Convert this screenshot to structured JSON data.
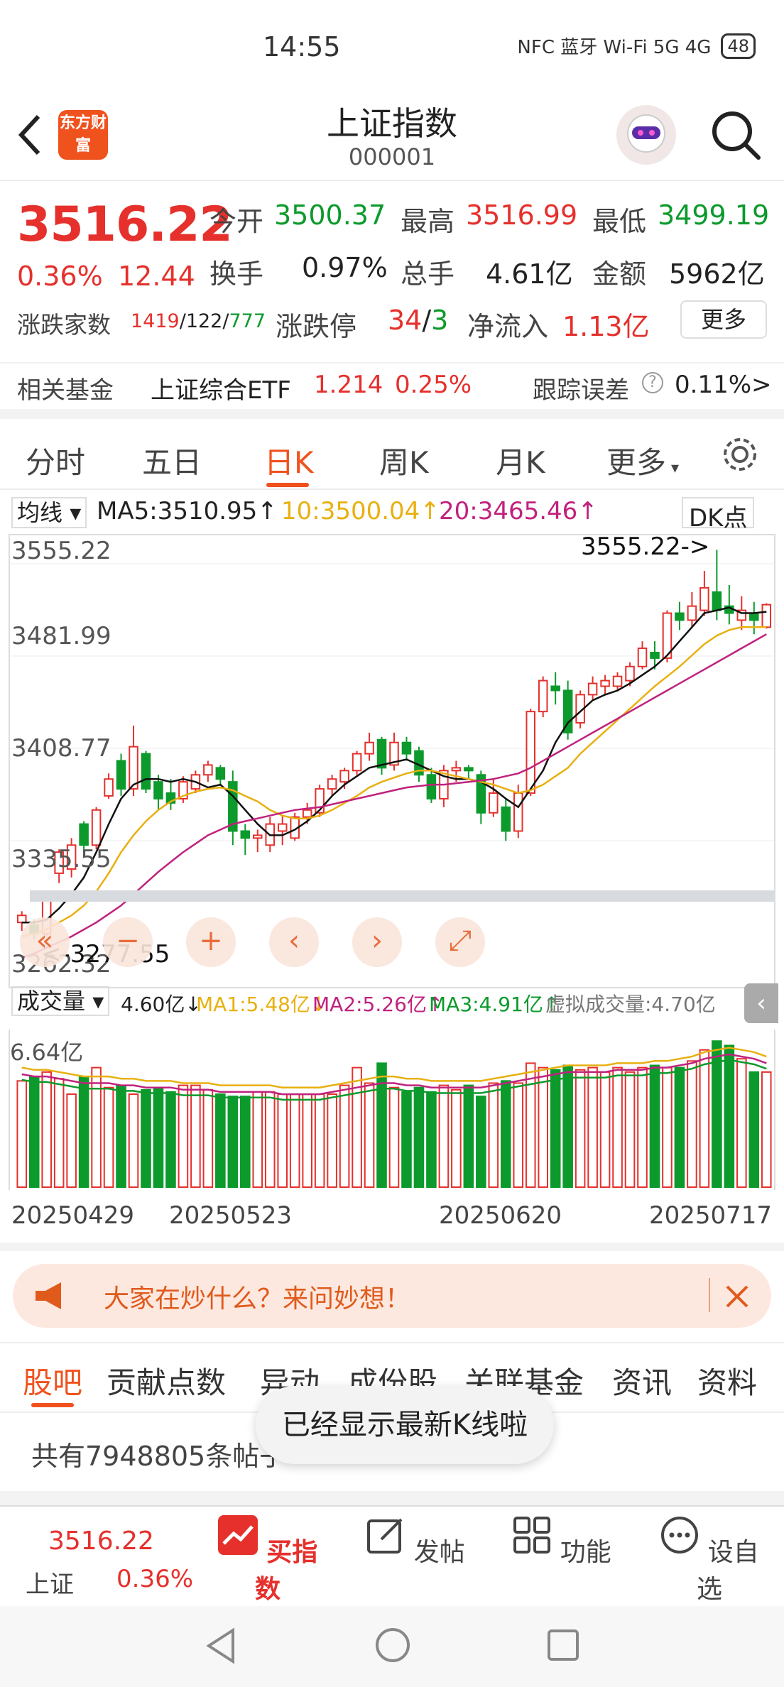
{
  "status_bar": {
    "time": "14:55",
    "icons": "NFC 蓝牙 Wi-Fi 5G 4G",
    "battery": "48"
  },
  "nav": {
    "logo": "东方财富",
    "title": "上证指数",
    "code": "000001"
  },
  "quote": {
    "price": "3516.22",
    "pct": "0.36%",
    "change": "12.44",
    "open_label": "今开",
    "open": "3500.37",
    "high_label": "最高",
    "high": "3516.99",
    "low_label": "最低",
    "low": "3499.19",
    "turnover_label": "换手",
    "turnover": "0.97%",
    "vol_label": "总手",
    "vol": "4.61亿",
    "amount_label": "金额",
    "amount": "5962亿",
    "breadth_label": "涨跌家数",
    "breadth_up": "1419",
    "breadth_flat": "122",
    "breadth_down": "777",
    "limit_label": "涨跌停",
    "limit_up": "34",
    "limit_down": "3",
    "inflow_label": "净流入",
    "inflow": "1.13亿",
    "more": "更多"
  },
  "fund": {
    "label": "相关基金",
    "name": "上证综合ETF",
    "price": "1.214",
    "pct": "0.25%",
    "err_label": "跟踪误差",
    "err": "0.11%"
  },
  "tabs": [
    "分时",
    "五日",
    "日K",
    "周K",
    "月K",
    "更多"
  ],
  "ma": {
    "select": "均线",
    "ma5": "MA5:3510.95↑",
    "ma10": "10:3500.04↑",
    "ma20": "20:3465.46↑",
    "dk": "DK点"
  },
  "chart_data": {
    "type": "candlestick",
    "y_ticks": [
      "3555.22",
      "3481.99",
      "3408.77",
      "3335.55",
      "3262.32"
    ],
    "ylim": [
      3262.32,
      3555.22
    ],
    "max_label": "3555.22->",
    "min_label": "<-3277.55",
    "candles": [
      [
        3290,
        3295,
        3284,
        3298
      ],
      [
        3288,
        3282,
        3278,
        3292
      ],
      [
        3282,
        3310,
        3280,
        3312
      ],
      [
        3325,
        3340,
        3318,
        3342
      ],
      [
        3328,
        3345,
        3322,
        3350
      ],
      [
        3360,
        3345,
        3340,
        3362
      ],
      [
        3345,
        3370,
        3342,
        3372
      ],
      [
        3380,
        3392,
        3378,
        3396
      ],
      [
        3405,
        3385,
        3380,
        3410
      ],
      [
        3385,
        3415,
        3380,
        3430
      ],
      [
        3410,
        3385,
        3382,
        3412
      ],
      [
        3390,
        3378,
        3370,
        3395
      ],
      [
        3382,
        3375,
        3370,
        3392
      ],
      [
        3378,
        3390,
        3375,
        3394
      ],
      [
        3385,
        3395,
        3382,
        3398
      ],
      [
        3395,
        3402,
        3390,
        3405
      ],
      [
        3400,
        3392,
        3388,
        3402
      ],
      [
        3390,
        3355,
        3345,
        3398
      ],
      [
        3355,
        3350,
        3338,
        3360
      ],
      [
        3350,
        3352,
        3340,
        3356
      ],
      [
        3345,
        3360,
        3340,
        3365
      ],
      [
        3355,
        3360,
        3345,
        3366
      ],
      [
        3350,
        3365,
        3348,
        3368
      ],
      [
        3365,
        3370,
        3360,
        3375
      ],
      [
        3368,
        3385,
        3365,
        3388
      ],
      [
        3385,
        3392,
        3380,
        3395
      ],
      [
        3390,
        3398,
        3385,
        3400
      ],
      [
        3398,
        3410,
        3395,
        3412
      ],
      [
        3410,
        3418,
        3405,
        3425
      ],
      [
        3420,
        3400,
        3395,
        3422
      ],
      [
        3402,
        3418,
        3398,
        3425
      ],
      [
        3418,
        3410,
        3405,
        3422
      ],
      [
        3412,
        3395,
        3390,
        3415
      ],
      [
        3395,
        3378,
        3375,
        3400
      ],
      [
        3378,
        3398,
        3372,
        3402
      ],
      [
        3398,
        3400,
        3390,
        3405
      ],
      [
        3400,
        3398,
        3392,
        3402
      ],
      [
        3395,
        3368,
        3360,
        3398
      ],
      [
        3368,
        3382,
        3365,
        3392
      ],
      [
        3372,
        3355,
        3348,
        3378
      ],
      [
        3355,
        3382,
        3350,
        3388
      ],
      [
        3382,
        3440,
        3380,
        3442
      ],
      [
        3440,
        3462,
        3436,
        3465
      ],
      [
        3458,
        3455,
        3445,
        3468
      ],
      [
        3455,
        3425,
        3420,
        3462
      ],
      [
        3432,
        3452,
        3428,
        3455
      ],
      [
        3452,
        3460,
        3448,
        3465
      ],
      [
        3458,
        3462,
        3452,
        3466
      ],
      [
        3458,
        3465,
        3455,
        3468
      ],
      [
        3462,
        3472,
        3458,
        3475
      ],
      [
        3472,
        3485,
        3470,
        3490
      ],
      [
        3482,
        3478,
        3470,
        3490
      ],
      [
        3478,
        3510,
        3475,
        3512
      ],
      [
        3510,
        3505,
        3498,
        3518
      ],
      [
        3505,
        3515,
        3500,
        3525
      ],
      [
        3512,
        3528,
        3508,
        3540
      ],
      [
        3525,
        3512,
        3505,
        3555
      ],
      [
        3515,
        3510,
        3502,
        3530
      ],
      [
        3505,
        3512,
        3498,
        3522
      ],
      [
        3510,
        3505,
        3495,
        3518
      ],
      [
        3500,
        3516,
        3499,
        3517
      ]
    ],
    "ma5": [
      3290,
      3290,
      3292,
      3300,
      3310,
      3322,
      3340,
      3360,
      3378,
      3388,
      3392,
      3392,
      3390,
      3392,
      3390,
      3386,
      3388,
      3380,
      3370,
      3360,
      3352,
      3352,
      3356,
      3362,
      3370,
      3380,
      3388,
      3394,
      3400,
      3402,
      3404,
      3406,
      3402,
      3398,
      3394,
      3392,
      3392,
      3390,
      3385,
      3378,
      3372,
      3385,
      3398,
      3418,
      3432,
      3440,
      3448,
      3452,
      3455,
      3460,
      3466,
      3472,
      3480,
      3490,
      3500,
      3510,
      3512,
      3514,
      3510,
      3510,
      3511
    ],
    "ma10": [
      3280,
      3282,
      3285,
      3290,
      3295,
      3302,
      3312,
      3325,
      3340,
      3352,
      3362,
      3370,
      3376,
      3380,
      3383,
      3385,
      3386,
      3384,
      3380,
      3376,
      3370,
      3366,
      3364,
      3364,
      3366,
      3370,
      3375,
      3380,
      3386,
      3390,
      3393,
      3396,
      3398,
      3398,
      3396,
      3394,
      3392,
      3390,
      3388,
      3385,
      3382,
      3384,
      3388,
      3394,
      3400,
      3410,
      3418,
      3426,
      3434,
      3442,
      3450,
      3458,
      3465,
      3472,
      3480,
      3488,
      3494,
      3498,
      3500,
      3500,
      3500
    ],
    "ma20": [
      3265,
      3268,
      3272,
      3276,
      3280,
      3285,
      3290,
      3296,
      3302,
      3310,
      3318,
      3326,
      3333,
      3340,
      3346,
      3352,
      3356,
      3360,
      3362,
      3364,
      3366,
      3368,
      3370,
      3371,
      3372,
      3374,
      3376,
      3378,
      3380,
      3382,
      3384,
      3386,
      3387,
      3388,
      3388,
      3389,
      3390,
      3391,
      3392,
      3394,
      3396,
      3400,
      3405,
      3410,
      3415,
      3420,
      3425,
      3430,
      3435,
      3440,
      3445,
      3450,
      3455,
      3460,
      3465,
      3470,
      3475,
      3480,
      3485,
      3490,
      3495
    ]
  },
  "chart_controls": [
    "back-icon",
    "zoom-out-icon",
    "zoom-in-icon",
    "pan-left-icon",
    "pan-right-icon",
    "fullscreen-icon"
  ],
  "volume": {
    "select": "成交量",
    "vol": "4.60亿↓",
    "ma1": "MA1:5.48亿↓",
    "ma2": "MA2:5.26亿↑",
    "ma3": "MA3:4.91亿↑",
    "virtual": "虚拟成交量:4.70亿",
    "max_label": "6.64亿",
    "values": [
      4.8,
      5.0,
      5.2,
      4.9,
      4.2,
      5.0,
      5.4,
      4.5,
      4.6,
      4.2,
      4.4,
      4.5,
      4.3,
      4.6,
      4.6,
      4.4,
      4.2,
      4.1,
      4.1,
      4.3,
      4.3,
      4.2,
      4.2,
      4.2,
      4.2,
      4.2,
      4.6,
      5.4,
      4.7,
      5.6,
      4.5,
      4.3,
      4.5,
      4.3,
      4.6,
      4.4,
      4.6,
      4.1,
      4.7,
      4.8,
      4.7,
      5.6,
      5.4,
      5.3,
      5.5,
      5.3,
      5.4,
      5.2,
      5.4,
      5.2,
      5.4,
      5.5,
      5.4,
      5.4,
      5.7,
      6.2,
      6.6,
      6.4,
      5.8,
      5.2,
      5.2
    ],
    "ma_line": [
      5.1,
      5.0,
      5.0,
      4.9,
      4.8,
      4.7,
      4.7,
      4.7,
      4.6,
      4.6,
      4.5,
      4.5,
      4.5,
      4.4,
      4.4,
      4.4,
      4.3,
      4.3,
      4.3,
      4.3,
      4.3,
      4.2,
      4.2,
      4.2,
      4.2,
      4.3,
      4.4,
      4.5,
      4.6,
      4.7,
      4.7,
      4.6,
      4.6,
      4.5,
      4.5,
      4.5,
      4.5,
      4.5,
      4.6,
      4.7,
      4.8,
      4.9,
      5.0,
      5.1,
      5.2,
      5.2,
      5.2,
      5.2,
      5.3,
      5.3,
      5.3,
      5.4,
      5.4,
      5.5,
      5.6,
      5.8,
      5.9,
      6.0,
      5.9,
      5.8,
      5.6
    ]
  },
  "dates": [
    "20250429",
    "20250523",
    "20250620",
    "20250717"
  ],
  "banner": {
    "text": "大家在炒什么？来问妙想！"
  },
  "bottom_tabs": [
    "股吧",
    "贡献点数",
    "异动",
    "成份股",
    "关联基金",
    "资讯",
    "资料"
  ],
  "post_count": "共有7948805条帖子",
  "toast": "已经显示最新K线啦",
  "toolbar": {
    "price": "3516.22",
    "name": "上证",
    "pct": "0.36%",
    "buy": "买指数",
    "post": "发帖",
    "func": "功能",
    "watch": "设自选"
  },
  "colors": {
    "up": "#e5302c",
    "down": "#0c9a2c",
    "accent": "#f0521e",
    "ma5": "#111111",
    "ma10": "#e8b010",
    "ma20": "#c0227e"
  }
}
